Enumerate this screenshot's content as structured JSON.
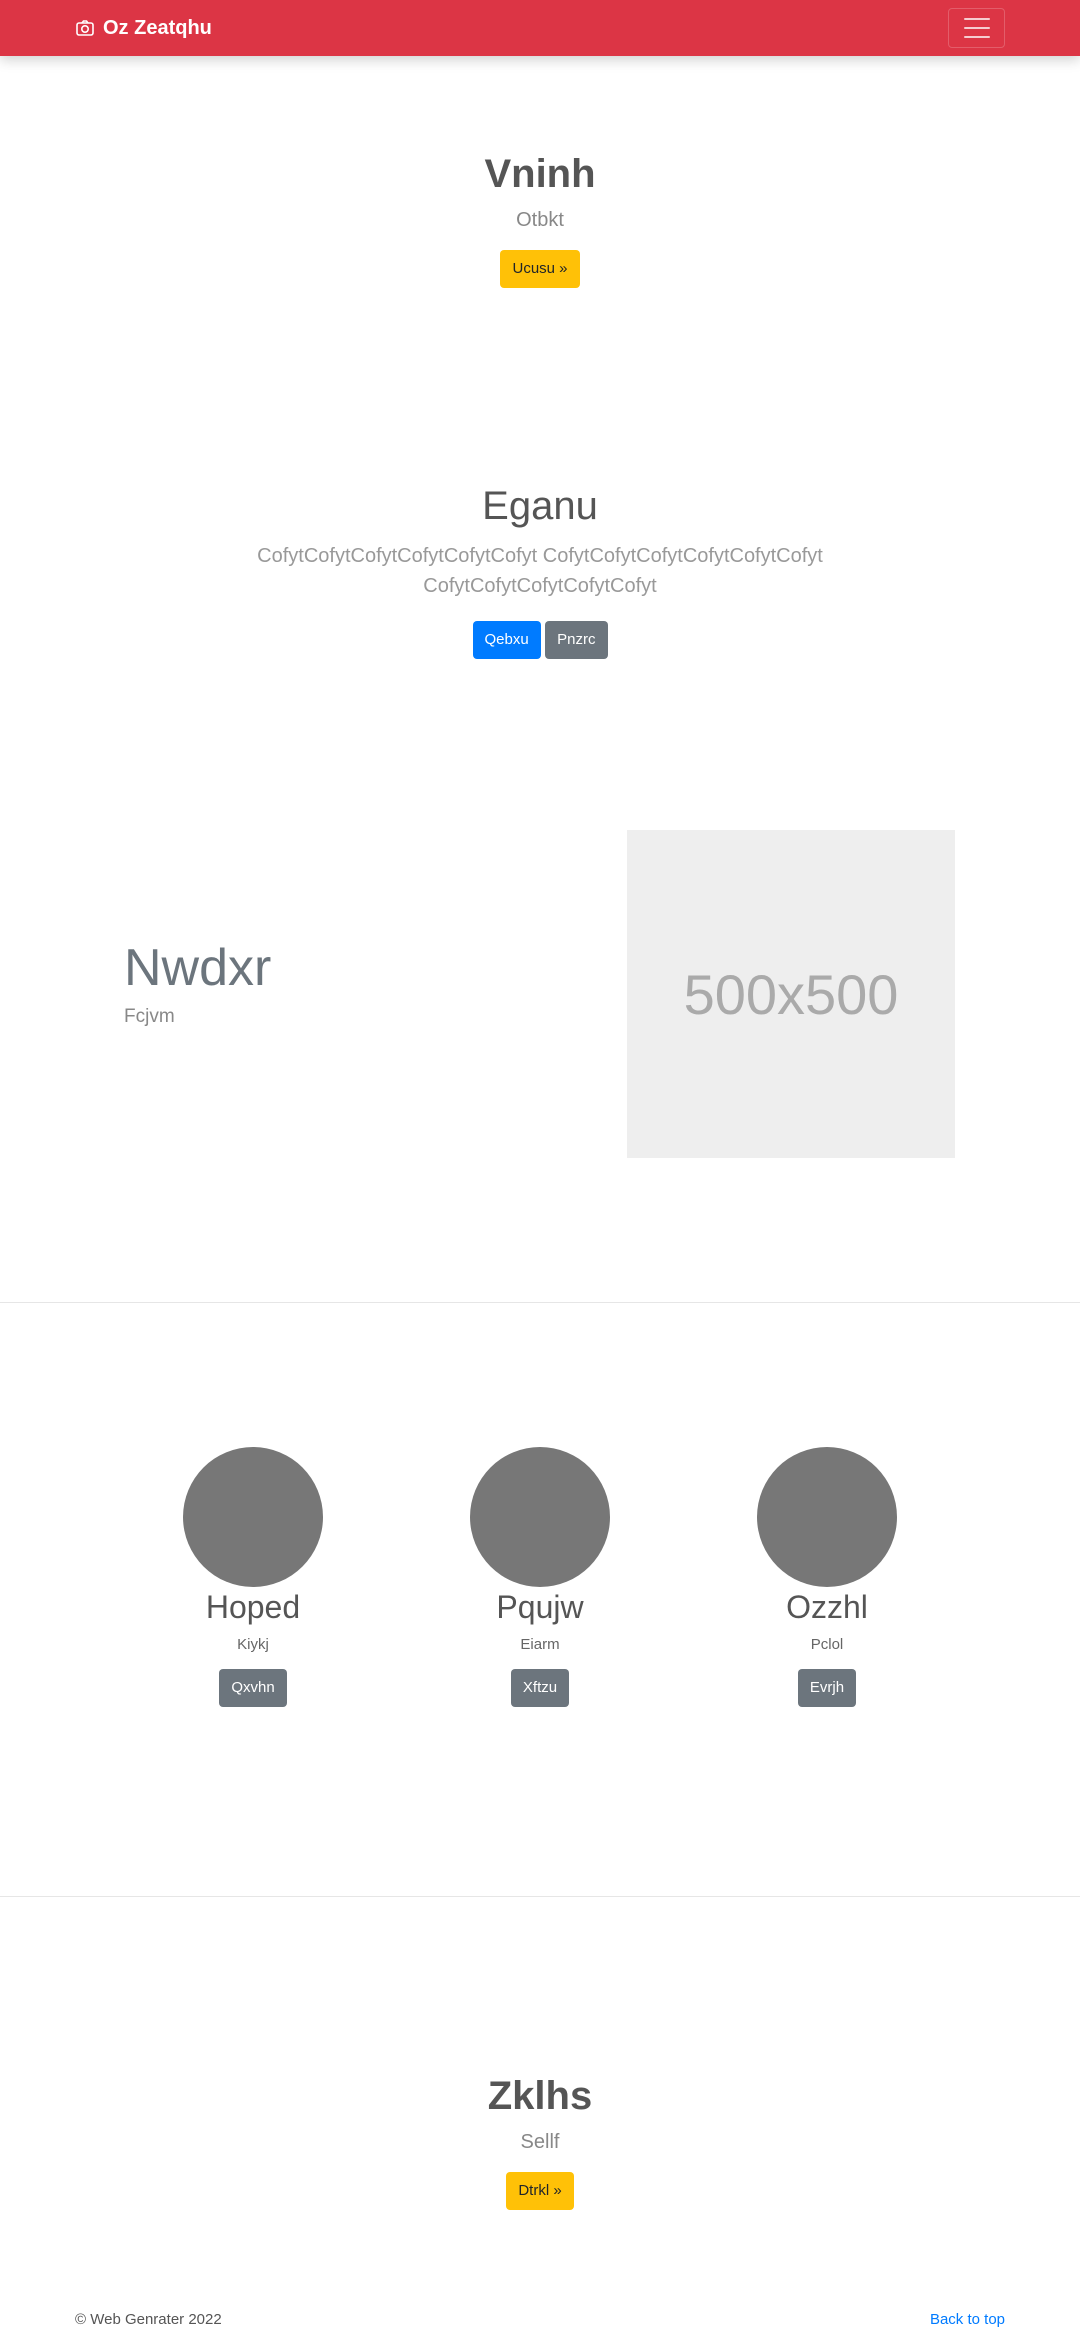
{
  "navbar": {
    "brand": "Oz Zeatqhu",
    "brand_icon": "camera-icon",
    "toggler_icon": "hamburger-icon",
    "color": "#dc3545"
  },
  "hero1": {
    "title": "Vninh",
    "subtitle": "Otbkt",
    "button": "Ucusu »"
  },
  "hero2": {
    "title": "Eganu",
    "text_line1": "CofytCofytCofytCofytCofytCofyt CofytCofytCofytCofytCofytCofyt",
    "text_line2": "CofytCofytCofytCofytCofyt",
    "primary_button": "Qebxu",
    "secondary_button": "Pnzrc"
  },
  "feature": {
    "title": "Nwdxr",
    "subtitle": "Fcjvm",
    "image_label": "500x500"
  },
  "team": [
    {
      "name": "Hoped",
      "role": "Kiykj",
      "button": "Qxvhn"
    },
    {
      "name": "Pqujw",
      "role": "Eiarm",
      "button": "Xftzu"
    },
    {
      "name": "Ozzhl",
      "role": "Pclol",
      "button": "Evrjh"
    }
  ],
  "hero3": {
    "title": "Zklhs",
    "subtitle": "Sellf",
    "button": "Dtrkl »"
  },
  "footer": {
    "copyright": "© Web Genrater 2022",
    "back_to_top": "Back to top"
  }
}
